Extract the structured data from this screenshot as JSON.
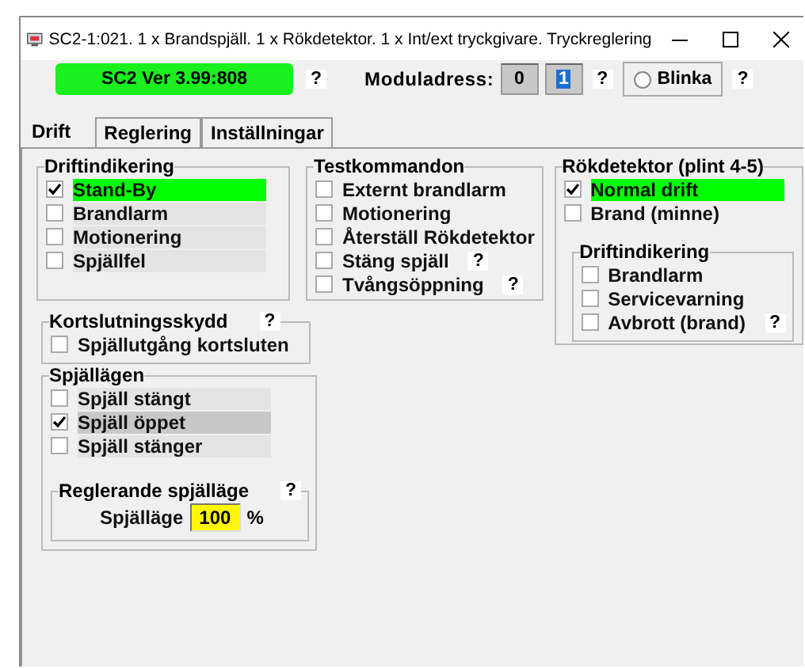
{
  "window": {
    "title": "SC2-1:021. 1 x Brandspjäll. 1 x Rökdetektor. 1 x Int/ext tryckgivare. Tryckreglering"
  },
  "header": {
    "version": "SC2 Ver 3.99:808",
    "version_help": "?",
    "address_label": "Moduladress:",
    "address_fields": [
      {
        "value": "0",
        "selected": false
      },
      {
        "value": "1",
        "selected": true
      }
    ],
    "address_help": "?",
    "blink": {
      "label": "Blinka",
      "selected": false
    },
    "blink_help": "?"
  },
  "tabs": [
    {
      "label": "Drift",
      "selected": true
    },
    {
      "label": "Reglering",
      "selected": false
    },
    {
      "label": "Inställningar",
      "selected": false
    }
  ],
  "groups": [
    {
      "title": "Driftindikering",
      "items": [
        {
          "label": "Stand-By",
          "checked": true,
          "color": "#00ff00"
        },
        {
          "label": "Brandlarm",
          "checked": false,
          "color": "#e4e4e4"
        },
        {
          "label": "Motionering",
          "checked": false,
          "color": "#e4e4e4"
        },
        {
          "label": "Spjällfel",
          "checked": false,
          "color": "#e4e4e4"
        }
      ]
    },
    {
      "title": "Testkommandon",
      "items": [
        {
          "label": "Externt brandlarm",
          "checked": false
        },
        {
          "label": "Motionering",
          "checked": false
        },
        {
          "label": "Återställ Rökdetektor",
          "checked": false
        },
        {
          "label": "Stäng spjäll",
          "checked": false,
          "help": "?"
        },
        {
          "label": "Tvångsöppning",
          "checked": false,
          "help": "?"
        }
      ]
    },
    {
      "title": "Rökdetektor (plint 4-5)",
      "items": [
        {
          "label": "Normal drift",
          "checked": true,
          "color": "#00ff00"
        },
        {
          "label": "Brand (minne)",
          "checked": false
        }
      ],
      "groups": [
        {
          "title": "Driftindikering",
          "items": [
            {
              "label": "Brandlarm",
              "checked": false
            },
            {
              "label": "Servicevarning",
              "checked": false
            },
            {
              "label": "Avbrott (brand)",
              "checked": false,
              "help": "?"
            }
          ]
        }
      ]
    },
    {
      "title": "Kortslutningsskydd",
      "help": "?",
      "items": [
        {
          "label": "Spjällutgång kortsluten",
          "checked": false
        }
      ]
    },
    {
      "title": "Spjällägen",
      "items": [
        {
          "label": "Spjäll stängt",
          "checked": false,
          "color": "#e4e4e4"
        },
        {
          "label": "Spjäll öppet",
          "checked": true,
          "color": "#c8c8c8"
        },
        {
          "label": "Spjäll stänger",
          "checked": false,
          "color": "#e4e4e4"
        }
      ],
      "groups": [
        {
          "title": "Reglerande spjälläge",
          "help": "?",
          "field": {
            "label": "Spjälläge",
            "value": "100",
            "unit": "%"
          }
        }
      ]
    }
  ]
}
